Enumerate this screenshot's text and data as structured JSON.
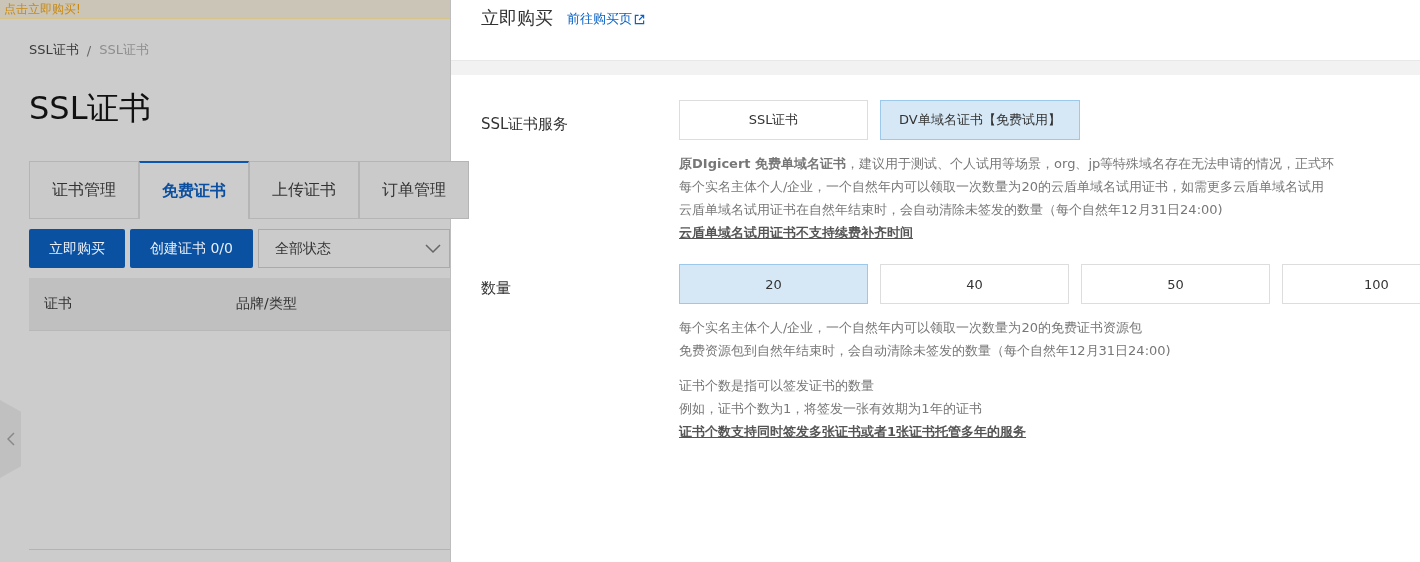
{
  "banner": {
    "text": "点击立即购买!"
  },
  "breadcrumb": {
    "items": [
      "SSL证书",
      "SSL证书"
    ],
    "separator": "/"
  },
  "page_title": "SSL证书",
  "tabs": [
    {
      "label": "证书管理",
      "selected": false
    },
    {
      "label": "免费证书",
      "selected": true
    },
    {
      "label": "上传证书",
      "selected": false
    },
    {
      "label": "订单管理",
      "selected": false
    }
  ],
  "toolbar": {
    "buttons": [
      "立即购买",
      "创建证书 0/0"
    ],
    "status_select": "全部状态"
  },
  "table": {
    "columns": [
      "证书",
      "品牌/类型"
    ]
  },
  "drawer": {
    "title": "立即购买",
    "link": "前往购买页",
    "sections": [
      {
        "label": "SSL证书服务",
        "options": [
          {
            "label": "SSL证书",
            "selected": false
          },
          {
            "label": "DV单域名证书【免费试用】",
            "selected": true
          }
        ],
        "notes": [
          [
            {
              "text": "**原DIgicert 免费单域名证书**，建议用于测试、个人试用等场景，org、jp等特殊域名存在无法申请的情况，正式环",
              "kind": "plain"
            },
            {
              "text": "每个实名主体个人/企业，一个自然年内可以领取一次数量为20的云盾单域名试用证书，如需更多云盾单域名试用",
              "kind": "plain"
            },
            {
              "text": "云盾单域名试用证书在自然年结束时，会自动清除未签发的数量（每个自然年12月31日24:00)",
              "kind": "plain"
            },
            {
              "text": "云盾单域名试用证书不支持续费补齐时间",
              "kind": "emphasis"
            }
          ]
        ]
      },
      {
        "label": "数量",
        "options": [
          {
            "label": "20",
            "selected": true
          },
          {
            "label": "40",
            "selected": false
          },
          {
            "label": "50",
            "selected": false
          },
          {
            "label": "100",
            "selected": false
          }
        ],
        "notes": [
          [
            {
              "text": "每个实名主体个人/企业，一个自然年内可以领取一次数量为20的免费证书资源包",
              "kind": "plain"
            },
            {
              "text": "免费资源包到自然年结束时，会自动清除未签发的数量（每个自然年12月31日24:00)",
              "kind": "plain"
            }
          ],
          [
            {
              "text": "证书个数是指可以签发证书的数量",
              "kind": "plain"
            },
            {
              "text": "例如，证书个数为1，将签发一张有效期为1年的证书",
              "kind": "plain"
            },
            {
              "text": "证书个数支持同时签发多张证书或者1张证书托管多年的服务",
              "kind": "emphasis"
            }
          ]
        ]
      }
    ]
  }
}
